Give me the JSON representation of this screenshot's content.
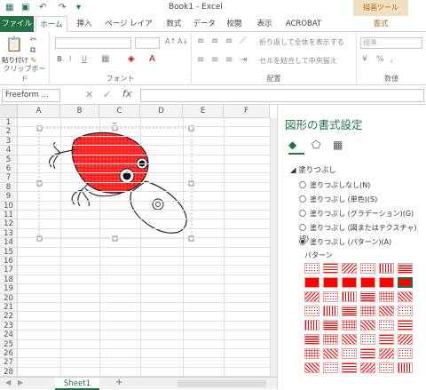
{
  "titlebar": {
    "title": "Book1 - Excel",
    "context_tab": "描画ツール"
  },
  "tabs": [
    "ファイル",
    "ホーム",
    "挿入",
    "ページ レイアウト",
    "数式",
    "データ",
    "校閲",
    "表示",
    "ACROBAT",
    "書式"
  ],
  "ribbon": {
    "paste_label": "貼り付け",
    "groups": {
      "clipboard": "クリップボード",
      "font": "フォント",
      "alignment": "配置",
      "number": "数値"
    },
    "wrap_text": "折り返して全体を表示する",
    "merge_center": "セルを結合して中央揃え",
    "number_format": "標準",
    "bold": "B",
    "italic": "I",
    "underline": "U"
  },
  "formulabar": {
    "namebox": "Freeform ...",
    "fx": "fx",
    "cancel": "✕",
    "enter": "✓"
  },
  "grid": {
    "columns": [
      "A",
      "B",
      "C",
      "D",
      "E",
      "F"
    ],
    "rows": [
      "1",
      "2",
      "3",
      "4",
      "5",
      "6",
      "7",
      "8",
      "9",
      "10",
      "11",
      "12",
      "13",
      "14",
      "15",
      "16",
      "17",
      "18",
      "19",
      "20",
      "21",
      "22",
      "23",
      "24",
      "25",
      "26",
      "27",
      "28"
    ]
  },
  "sheets": {
    "active": "Sheet1",
    "add": "+"
  },
  "pane": {
    "title": "図形の書式設定",
    "section": "塗りつぶし",
    "options": [
      {
        "label": "塗りつぶしなし(N)",
        "selected": false
      },
      {
        "label": "塗りつぶし (単色)(S)",
        "selected": false
      },
      {
        "label": "塗りつぶし (グラデーション)(G)",
        "selected": false
      },
      {
        "label": "塗りつぶし (図またはテクスチャ)(P)",
        "selected": false
      },
      {
        "label": "塗りつぶし (パターン)(A)",
        "selected": true
      }
    ],
    "pattern_label": "パターン",
    "icons": [
      "fill-line-icon",
      "effects-icon",
      "size-properties-icon"
    ],
    "pattern_color": "#ff0000"
  },
  "colors": {
    "accent": "#217346",
    "shape_fill": "#ff2020",
    "context": "#b0681b"
  }
}
